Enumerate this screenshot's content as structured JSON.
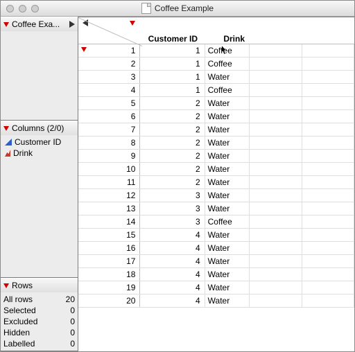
{
  "window": {
    "title": "Coffee Example"
  },
  "sidebar": {
    "source_label": "Coffee Exa...",
    "columns_label": "Columns (2/0)",
    "columns": [
      {
        "name": "Customer ID",
        "icon": "continuous"
      },
      {
        "name": "Drink",
        "icon": "nominal"
      }
    ],
    "rows_label": "Rows",
    "rows_stats": {
      "all_label": "All rows",
      "all_value": "20",
      "selected_label": "Selected",
      "selected_value": "0",
      "excluded_label": "Excluded",
      "excluded_value": "0",
      "hidden_label": "Hidden",
      "hidden_value": "0",
      "labelled_label": "Labelled",
      "labelled_value": "0"
    }
  },
  "table": {
    "headers": {
      "customer": "Customer ID",
      "drink": "Drink"
    },
    "rows": [
      {
        "n": "1",
        "c": "1",
        "d": "Coffee"
      },
      {
        "n": "2",
        "c": "1",
        "d": "Coffee"
      },
      {
        "n": "3",
        "c": "1",
        "d": "Water"
      },
      {
        "n": "4",
        "c": "1",
        "d": "Coffee"
      },
      {
        "n": "5",
        "c": "2",
        "d": "Water"
      },
      {
        "n": "6",
        "c": "2",
        "d": "Water"
      },
      {
        "n": "7",
        "c": "2",
        "d": "Water"
      },
      {
        "n": "8",
        "c": "2",
        "d": "Water"
      },
      {
        "n": "9",
        "c": "2",
        "d": "Water"
      },
      {
        "n": "10",
        "c": "2",
        "d": "Water"
      },
      {
        "n": "11",
        "c": "2",
        "d": "Water"
      },
      {
        "n": "12",
        "c": "3",
        "d": "Water"
      },
      {
        "n": "13",
        "c": "3",
        "d": "Water"
      },
      {
        "n": "14",
        "c": "3",
        "d": "Coffee"
      },
      {
        "n": "15",
        "c": "4",
        "d": "Water"
      },
      {
        "n": "16",
        "c": "4",
        "d": "Water"
      },
      {
        "n": "17",
        "c": "4",
        "d": "Water"
      },
      {
        "n": "18",
        "c": "4",
        "d": "Water"
      },
      {
        "n": "19",
        "c": "4",
        "d": "Water"
      },
      {
        "n": "20",
        "c": "4",
        "d": "Water"
      }
    ]
  }
}
